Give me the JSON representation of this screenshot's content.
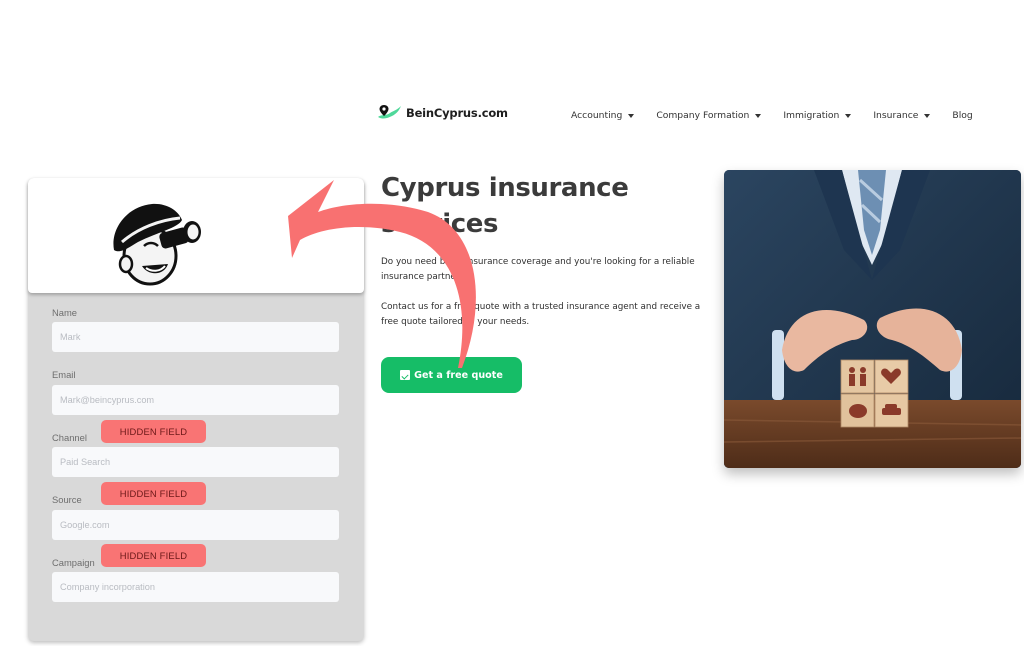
{
  "header": {
    "logo_text": "BeinCyprus.com",
    "nav": [
      {
        "label": "Accounting",
        "has_dropdown": true
      },
      {
        "label": "Company Formation",
        "has_dropdown": true
      },
      {
        "label": "Immigration",
        "has_dropdown": true
      },
      {
        "label": "Insurance",
        "has_dropdown": true
      },
      {
        "label": "Blog",
        "has_dropdown": false
      }
    ]
  },
  "hero": {
    "title": "Cyprus insurance services",
    "paragraph1": "Do you need basic insurance coverage and you're looking for a reliable insurance partner?",
    "paragraph2": "Contact us for a free quote with a trusted insurance agent and receive a free quote tailored to your needs.",
    "cta_label": "Get a free quote",
    "cta_icon": "calendar-check-icon",
    "image_alt": "Businessman shielding wooden insurance blocks with hands",
    "block_icons": [
      "family-icon",
      "heart-icon",
      "piggy-bank-icon",
      "car-icon"
    ]
  },
  "form": {
    "logo": "mailchimp-freddie-icon",
    "fields": [
      {
        "label": "Name",
        "placeholder": "Mark",
        "hidden": false
      },
      {
        "label": "Email",
        "placeholder": "Mark@beincyprus.com",
        "hidden": false
      },
      {
        "label": "Channel",
        "placeholder": "Paid Search",
        "hidden": true
      },
      {
        "label": "Source",
        "placeholder": "Google.com",
        "hidden": true
      },
      {
        "label": "Campaign",
        "placeholder": "Company incorporation",
        "hidden": true
      }
    ],
    "hidden_badge_label": "HIDDEN FIELD"
  },
  "colors": {
    "brand_green": "#16bd67",
    "logo_green": "#4fd89a",
    "badge_red": "#f97474",
    "arrow_red": "#f87171",
    "card_gray": "#d9d9d9"
  }
}
